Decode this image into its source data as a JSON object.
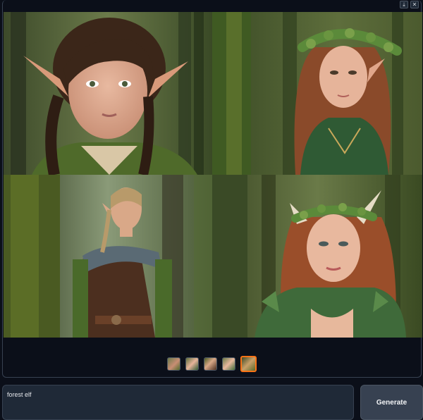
{
  "toolbar": {
    "download_icon": "download-icon",
    "close_icon": "close-icon",
    "download_glyph": "⤓",
    "close_glyph": "✕"
  },
  "gallery": {
    "images": [
      {
        "subject": "young elf with braids",
        "selected": false
      },
      {
        "subject": "elf woman with leaf crown",
        "selected": false
      },
      {
        "subject": "male elf ranger",
        "selected": false
      },
      {
        "subject": "elf woman in leaf armor",
        "selected": true
      }
    ]
  },
  "prompt": {
    "value": "forest elf"
  },
  "generate": {
    "label": "Generate"
  },
  "colors": {
    "accent": "#f97316",
    "panel": "#1f2937",
    "background": "#0b0f19"
  }
}
